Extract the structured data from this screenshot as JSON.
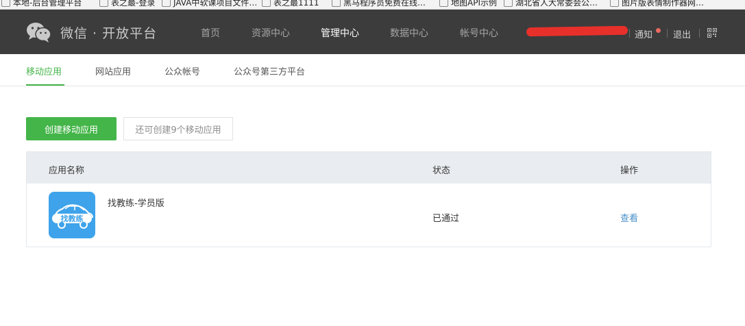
{
  "browser": {
    "bookmarks": [
      "本地-后台管理平台",
      "表之最-登录",
      "JAVA中软课项目文件…",
      "表之最1111",
      "黑马程序员免费在线…",
      "地图API示例",
      "湖北省人大常委会公…",
      "图片版表情制作器网…"
    ]
  },
  "header": {
    "logo_text": "微信 · 开放平台",
    "nav": [
      {
        "label": "首页"
      },
      {
        "label": "资源中心"
      },
      {
        "label": "管理中心"
      },
      {
        "label": "数据中心"
      },
      {
        "label": "帐号中心"
      }
    ],
    "active_nav": "管理中心",
    "notice_label": "通知",
    "logout_label": "退出"
  },
  "subnav": {
    "tabs": [
      {
        "label": "移动应用"
      },
      {
        "label": "网站应用"
      },
      {
        "label": "公众帐号"
      },
      {
        "label": "公众号第三方平台"
      }
    ],
    "active_tab": "移动应用"
  },
  "actions": {
    "create_button": "创建移动应用",
    "quota_text": "还可创建9个移动应用"
  },
  "table": {
    "headers": {
      "name": "应用名称",
      "status": "状态",
      "action": "操作"
    },
    "rows": [
      {
        "name": "找教练-学员版",
        "icon_text": "找教练",
        "status": "已通过",
        "action": "查看"
      }
    ]
  },
  "colors": {
    "accent_green": "#44b549",
    "nav_bg": "#3c3c3c",
    "link_blue": "#4a90c9",
    "app_icon_bg": "#3ea3ea",
    "redaction": "#e8302b"
  }
}
